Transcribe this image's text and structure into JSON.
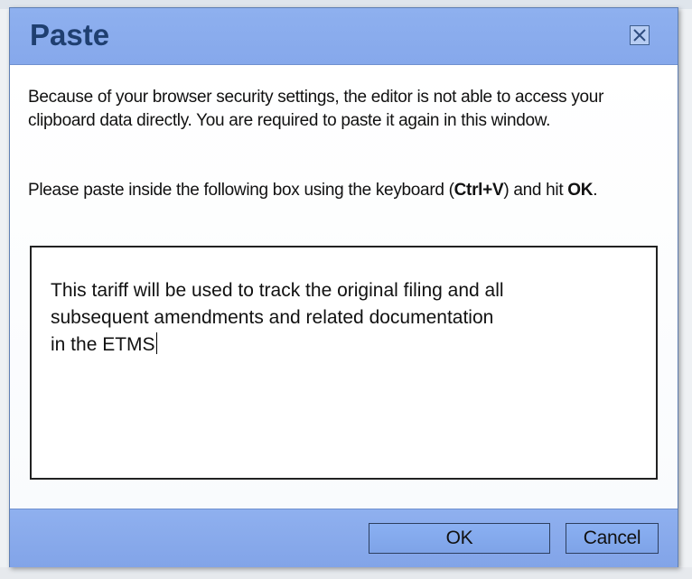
{
  "dialog": {
    "title": "Paste",
    "close_icon": "close-icon",
    "message_line": "Because of your browser security settings, the editor is not able to access your clipboard data directly. You are required to paste it again in this window.",
    "instruction_prefix": "Please paste inside the following box using the keyboard (",
    "instruction_shortcut": "Ctrl+V",
    "instruction_middle": ") and hit ",
    "instruction_ok": "OK",
    "instruction_suffix": ".",
    "pasted_text": "This tariff will be used to track the original filing and all\nsubsequent amendments and related documentation\nin the ETMS",
    "buttons": {
      "ok_label": "OK",
      "cancel_label": "Cancel"
    }
  },
  "colors": {
    "title_bar": "#8eb0ef",
    "title_text": "#1f3f70",
    "footer": "#86a8eb",
    "button_bg": "#7ea3e8"
  }
}
